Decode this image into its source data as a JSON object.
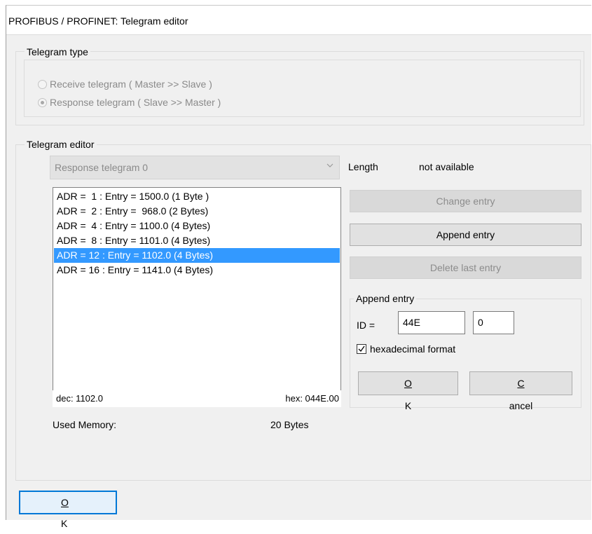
{
  "window": {
    "title": "PROFIBUS / PROFINET: Telegram editor"
  },
  "telegram_type": {
    "legend": "Telegram type",
    "options": [
      {
        "label": "Receive telegram ( Master >> Slave )",
        "checked": false
      },
      {
        "label": "Response telegram ( Slave >> Master )",
        "checked": true
      }
    ]
  },
  "editor": {
    "legend": "Telegram editor",
    "telegram_select": {
      "value": "Response telegram 0"
    },
    "length_label": "Length",
    "length_value": "not available",
    "entries": [
      "ADR =  1 : Entry = 1500.0 (1 Byte )",
      "ADR =  2 : Entry =  968.0 (2 Bytes)",
      "ADR =  4 : Entry = 1100.0 (4 Bytes)",
      "ADR =  8 : Entry = 1101.0 (4 Bytes)",
      "ADR = 12 : Entry = 1102.0 (4 Bytes)",
      "ADR = 16 : Entry = 1141.0 (4 Bytes)"
    ],
    "selected_index": 4,
    "dec_value": "dec: 1102.0",
    "hex_value": "hex: 044E.00",
    "used_memory_label": "Used Memory:",
    "used_memory_value": "20 Bytes",
    "change_entry_label": "Change entry",
    "append_entry_label": "Append entry",
    "delete_last_entry_label": "Delete last entry"
  },
  "append_group": {
    "legend": "Append entry",
    "id_label": "ID =",
    "id_value": "44E",
    "id_second_value": "0",
    "hex_format_label": "hexadecimal format",
    "hex_format_checked": true,
    "ok_label": "OK",
    "cancel_label": "Cancel"
  },
  "footer": {
    "ok_label": "OK"
  },
  "colors": {
    "selection": "#3399ff",
    "default_button_border": "#0078d7",
    "dialog_background": "#f0f0f0"
  }
}
